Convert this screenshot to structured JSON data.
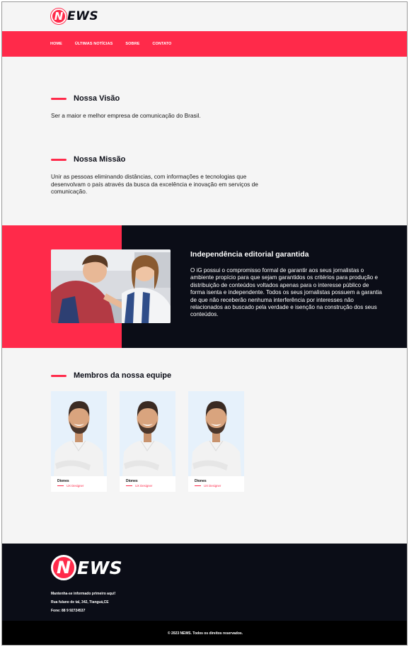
{
  "brand": {
    "logo_letter": "N",
    "logo_rest": "EWS",
    "accent_color": "#ff2a4a",
    "dark_color": "#0b0d17"
  },
  "nav": {
    "items": [
      "HOME",
      "ÚLTIMAS NOTÍCIAS",
      "SOBRE",
      "CONTATO"
    ]
  },
  "vision": {
    "title": "Nossa Visão",
    "text": "Ser a maior e melhor empresa de comunicação do Brasil."
  },
  "mission": {
    "title": "Nossa Missão",
    "text": "Unir as pessoas eliminando distâncias, com informações e tecnologias que desenvolvam o país através da busca da excelência e inovação em serviços de comunicação."
  },
  "independence": {
    "title": "Independência editorial garantida",
    "text": "O iG possui o compromisso formal de garantir aos seus jornalistas o ambiente propício para que sejam garantidos os critérios para produção e distribuição de conteúdos voltados apenas para o interesse público de forma isenta e independente. Todos os seus jornalistas possuem a garantia de que não receberão nenhuma interferência por interesses não relacionados ao buscado pela verdade e isenção na construção dos seus conteúdos."
  },
  "team": {
    "title": "Membros da nossa equipe",
    "members": [
      {
        "name": "Diones",
        "role": "UX Designer"
      },
      {
        "name": "Diones",
        "role": "UX Designer"
      },
      {
        "name": "Diones",
        "role": "UX Designer"
      }
    ]
  },
  "footer": {
    "tagline": "Mantenha-se informado primeiro aqui!",
    "address": "Rua fulano de tal, 342,  Tianguá,CE",
    "phone": "Fone: 88 9 92724537",
    "copyright": "© 2023 NEWS. Todos os direitos reservados."
  }
}
